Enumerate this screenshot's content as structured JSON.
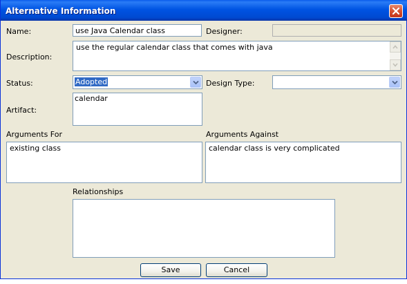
{
  "window": {
    "title": "Alternative Information"
  },
  "form": {
    "name_label": "Name:",
    "name_value": "use Java Calendar class",
    "designer_label": "Designer:",
    "designer_value": "",
    "description_label": "Description:",
    "description_value": "use the regular calendar class that comes with java",
    "status_label": "Status:",
    "status_value": "Adopted",
    "design_type_label": "Design Type:",
    "design_type_value": "",
    "artifact_label": "Artifact:",
    "artifact_value": "calendar",
    "arguments_for_label": "Arguments For",
    "arguments_for_value": "existing class",
    "arguments_against_label": "Arguments Against",
    "arguments_against_value": "calendar class is very complicated",
    "relationships_label": "Relationships",
    "relationships_value": ""
  },
  "buttons": {
    "save": "Save",
    "cancel": "Cancel"
  },
  "icons": {
    "close": "close-icon",
    "dropdown": "chevron-down-icon",
    "scroll_up": "scroll-up-arrow-icon",
    "scroll_down": "scroll-down-arrow-icon"
  }
}
